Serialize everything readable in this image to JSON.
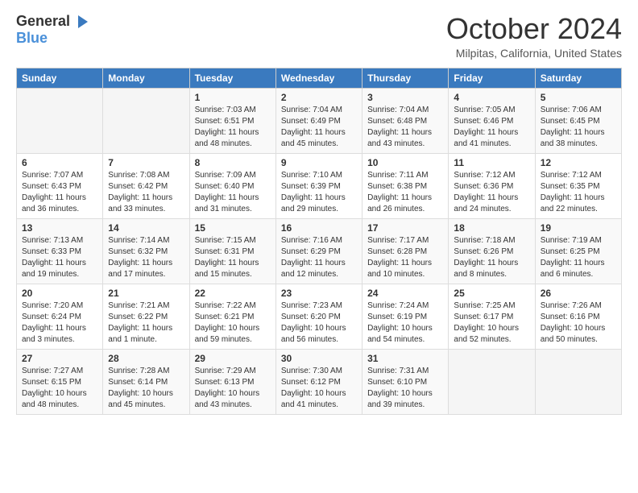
{
  "logo": {
    "general": "General",
    "blue": "Blue"
  },
  "title": "October 2024",
  "location": "Milpitas, California, United States",
  "days_of_week": [
    "Sunday",
    "Monday",
    "Tuesday",
    "Wednesday",
    "Thursday",
    "Friday",
    "Saturday"
  ],
  "weeks": [
    [
      {
        "day": "",
        "sunrise": "",
        "sunset": "",
        "daylight": ""
      },
      {
        "day": "",
        "sunrise": "",
        "sunset": "",
        "daylight": ""
      },
      {
        "day": "1",
        "sunrise": "Sunrise: 7:03 AM",
        "sunset": "Sunset: 6:51 PM",
        "daylight": "Daylight: 11 hours and 48 minutes."
      },
      {
        "day": "2",
        "sunrise": "Sunrise: 7:04 AM",
        "sunset": "Sunset: 6:49 PM",
        "daylight": "Daylight: 11 hours and 45 minutes."
      },
      {
        "day": "3",
        "sunrise": "Sunrise: 7:04 AM",
        "sunset": "Sunset: 6:48 PM",
        "daylight": "Daylight: 11 hours and 43 minutes."
      },
      {
        "day": "4",
        "sunrise": "Sunrise: 7:05 AM",
        "sunset": "Sunset: 6:46 PM",
        "daylight": "Daylight: 11 hours and 41 minutes."
      },
      {
        "day": "5",
        "sunrise": "Sunrise: 7:06 AM",
        "sunset": "Sunset: 6:45 PM",
        "daylight": "Daylight: 11 hours and 38 minutes."
      }
    ],
    [
      {
        "day": "6",
        "sunrise": "Sunrise: 7:07 AM",
        "sunset": "Sunset: 6:43 PM",
        "daylight": "Daylight: 11 hours and 36 minutes."
      },
      {
        "day": "7",
        "sunrise": "Sunrise: 7:08 AM",
        "sunset": "Sunset: 6:42 PM",
        "daylight": "Daylight: 11 hours and 33 minutes."
      },
      {
        "day": "8",
        "sunrise": "Sunrise: 7:09 AM",
        "sunset": "Sunset: 6:40 PM",
        "daylight": "Daylight: 11 hours and 31 minutes."
      },
      {
        "day": "9",
        "sunrise": "Sunrise: 7:10 AM",
        "sunset": "Sunset: 6:39 PM",
        "daylight": "Daylight: 11 hours and 29 minutes."
      },
      {
        "day": "10",
        "sunrise": "Sunrise: 7:11 AM",
        "sunset": "Sunset: 6:38 PM",
        "daylight": "Daylight: 11 hours and 26 minutes."
      },
      {
        "day": "11",
        "sunrise": "Sunrise: 7:12 AM",
        "sunset": "Sunset: 6:36 PM",
        "daylight": "Daylight: 11 hours and 24 minutes."
      },
      {
        "day": "12",
        "sunrise": "Sunrise: 7:12 AM",
        "sunset": "Sunset: 6:35 PM",
        "daylight": "Daylight: 11 hours and 22 minutes."
      }
    ],
    [
      {
        "day": "13",
        "sunrise": "Sunrise: 7:13 AM",
        "sunset": "Sunset: 6:33 PM",
        "daylight": "Daylight: 11 hours and 19 minutes."
      },
      {
        "day": "14",
        "sunrise": "Sunrise: 7:14 AM",
        "sunset": "Sunset: 6:32 PM",
        "daylight": "Daylight: 11 hours and 17 minutes."
      },
      {
        "day": "15",
        "sunrise": "Sunrise: 7:15 AM",
        "sunset": "Sunset: 6:31 PM",
        "daylight": "Daylight: 11 hours and 15 minutes."
      },
      {
        "day": "16",
        "sunrise": "Sunrise: 7:16 AM",
        "sunset": "Sunset: 6:29 PM",
        "daylight": "Daylight: 11 hours and 12 minutes."
      },
      {
        "day": "17",
        "sunrise": "Sunrise: 7:17 AM",
        "sunset": "Sunset: 6:28 PM",
        "daylight": "Daylight: 11 hours and 10 minutes."
      },
      {
        "day": "18",
        "sunrise": "Sunrise: 7:18 AM",
        "sunset": "Sunset: 6:26 PM",
        "daylight": "Daylight: 11 hours and 8 minutes."
      },
      {
        "day": "19",
        "sunrise": "Sunrise: 7:19 AM",
        "sunset": "Sunset: 6:25 PM",
        "daylight": "Daylight: 11 hours and 6 minutes."
      }
    ],
    [
      {
        "day": "20",
        "sunrise": "Sunrise: 7:20 AM",
        "sunset": "Sunset: 6:24 PM",
        "daylight": "Daylight: 11 hours and 3 minutes."
      },
      {
        "day": "21",
        "sunrise": "Sunrise: 7:21 AM",
        "sunset": "Sunset: 6:22 PM",
        "daylight": "Daylight: 11 hours and 1 minute."
      },
      {
        "day": "22",
        "sunrise": "Sunrise: 7:22 AM",
        "sunset": "Sunset: 6:21 PM",
        "daylight": "Daylight: 10 hours and 59 minutes."
      },
      {
        "day": "23",
        "sunrise": "Sunrise: 7:23 AM",
        "sunset": "Sunset: 6:20 PM",
        "daylight": "Daylight: 10 hours and 56 minutes."
      },
      {
        "day": "24",
        "sunrise": "Sunrise: 7:24 AM",
        "sunset": "Sunset: 6:19 PM",
        "daylight": "Daylight: 10 hours and 54 minutes."
      },
      {
        "day": "25",
        "sunrise": "Sunrise: 7:25 AM",
        "sunset": "Sunset: 6:17 PM",
        "daylight": "Daylight: 10 hours and 52 minutes."
      },
      {
        "day": "26",
        "sunrise": "Sunrise: 7:26 AM",
        "sunset": "Sunset: 6:16 PM",
        "daylight": "Daylight: 10 hours and 50 minutes."
      }
    ],
    [
      {
        "day": "27",
        "sunrise": "Sunrise: 7:27 AM",
        "sunset": "Sunset: 6:15 PM",
        "daylight": "Daylight: 10 hours and 48 minutes."
      },
      {
        "day": "28",
        "sunrise": "Sunrise: 7:28 AM",
        "sunset": "Sunset: 6:14 PM",
        "daylight": "Daylight: 10 hours and 45 minutes."
      },
      {
        "day": "29",
        "sunrise": "Sunrise: 7:29 AM",
        "sunset": "Sunset: 6:13 PM",
        "daylight": "Daylight: 10 hours and 43 minutes."
      },
      {
        "day": "30",
        "sunrise": "Sunrise: 7:30 AM",
        "sunset": "Sunset: 6:12 PM",
        "daylight": "Daylight: 10 hours and 41 minutes."
      },
      {
        "day": "31",
        "sunrise": "Sunrise: 7:31 AM",
        "sunset": "Sunset: 6:10 PM",
        "daylight": "Daylight: 10 hours and 39 minutes."
      },
      {
        "day": "",
        "sunrise": "",
        "sunset": "",
        "daylight": ""
      },
      {
        "day": "",
        "sunrise": "",
        "sunset": "",
        "daylight": ""
      }
    ]
  ]
}
